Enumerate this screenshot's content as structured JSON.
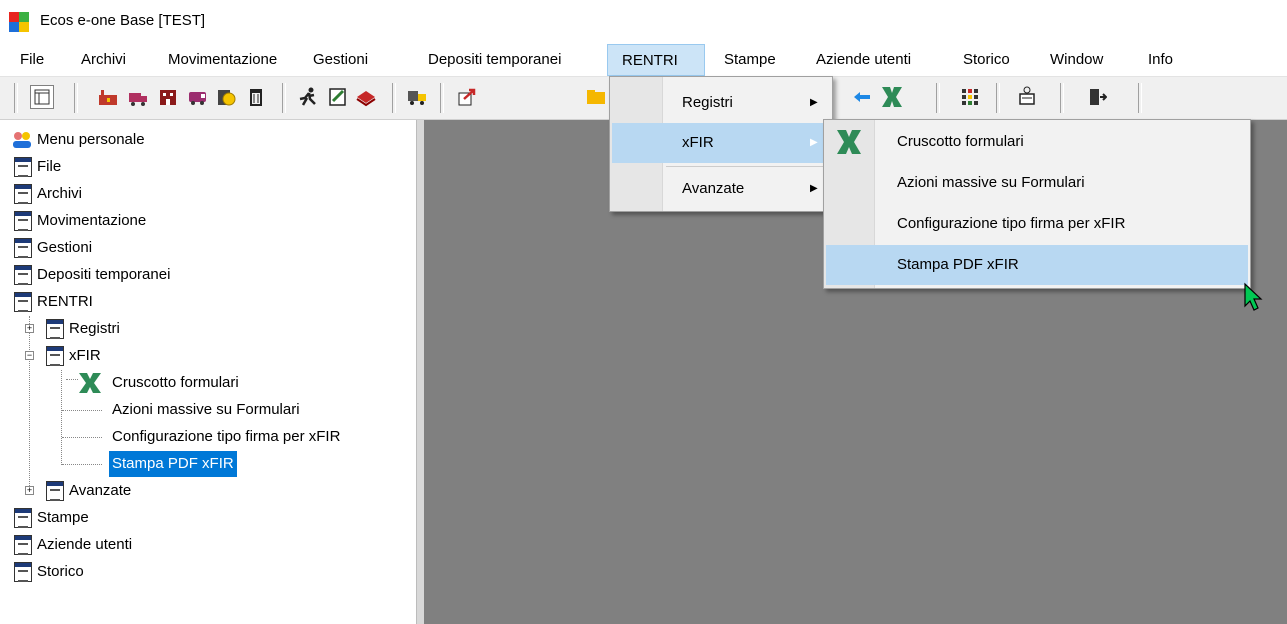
{
  "window": {
    "title": "Ecos e-one Base [TEST]",
    "logo_colors": [
      "#e8251f",
      "#3cb043",
      "#1e6fd9",
      "#f5c400"
    ]
  },
  "menubar": {
    "items": [
      "File",
      "Archivi",
      "Movimentazione",
      "Gestioni",
      "Depositi temporanei",
      "RENTRI",
      "Stampe",
      "Aziende utenti",
      "Storico",
      "Window",
      "Info"
    ],
    "active": "RENTRI"
  },
  "toolbar": {
    "buttons": [
      "layout-icon",
      "factory-icon",
      "truck-icon",
      "building-icon",
      "van-icon",
      "coin-icon",
      "trash-icon",
      "runner-icon",
      "edit-icon",
      "book-icon",
      "transport-icon",
      "export-icon",
      "folder-icon",
      "sync-icon",
      "xfir-icon",
      "grid-icon",
      "network-icon",
      "exit-icon"
    ]
  },
  "rentri_menu": {
    "items": [
      {
        "label": "Registri",
        "has_submenu": true
      },
      {
        "label": "xFIR",
        "has_submenu": true,
        "highlighted": true
      },
      {
        "label": "Avanzate",
        "has_submenu": true
      }
    ]
  },
  "xfir_submenu": {
    "items": [
      {
        "label": "Cruscotto formulari",
        "icon": "xfir-icon"
      },
      {
        "label": "Azioni massive su Formulari"
      },
      {
        "label": "Configurazione tipo firma per xFIR"
      },
      {
        "label": "Stampa PDF xFIR",
        "highlighted": true
      }
    ]
  },
  "tree": {
    "root": "Menu personale",
    "nodes": [
      "File",
      "Archivi",
      "Movimentazione",
      "Gestioni",
      "Depositi temporanei",
      "RENTRI"
    ],
    "rentri_children": [
      "Registri",
      "xFIR",
      "Avanzate"
    ],
    "xfir_children": [
      "Cruscotto formulari",
      "Azioni massive su Formulari",
      "Configurazione tipo firma per xFIR",
      "Stampa PDF xFIR"
    ],
    "selected": "Stampa PDF xFIR",
    "after": [
      "Stampe",
      "Aziende utenti",
      "Storico"
    ]
  },
  "colors": {
    "selection": "#0078d7",
    "menu_highlight": "#b8d8f2",
    "menubar_active": "#cce4f7",
    "mdi_background": "#808080",
    "xfir_icon": "#2e8b57"
  }
}
